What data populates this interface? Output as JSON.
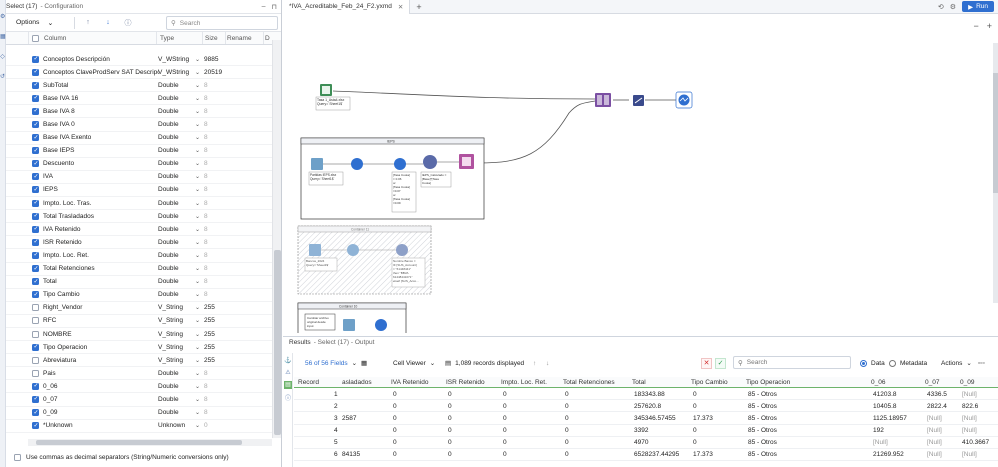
{
  "config": {
    "title": "Select (17)",
    "subtitle": "- Configuration",
    "options_label": "Options",
    "search_placeholder": "Search",
    "headers": {
      "column": "Column",
      "type": "Type",
      "size": "Size",
      "rename": "Rename",
      "desc": "D"
    },
    "rows": [
      {
        "name": "Conceptos Descripción",
        "type": "V_WString",
        "size": "9885",
        "checked": true
      },
      {
        "name": "Conceptos ClaveProdServ SAT Descripción",
        "type": "V_WString",
        "size": "20519",
        "checked": true
      },
      {
        "name": "SubTotal",
        "type": "Double",
        "size": "8",
        "checked": true
      },
      {
        "name": "Base IVA 16",
        "type": "Double",
        "size": "8",
        "checked": true
      },
      {
        "name": "Base IVA 8",
        "type": "Double",
        "size": "8",
        "checked": true
      },
      {
        "name": "Base IVA 0",
        "type": "Double",
        "size": "8",
        "checked": true
      },
      {
        "name": "Base IVA Exento",
        "type": "Double",
        "size": "8",
        "checked": true
      },
      {
        "name": "Base IEPS",
        "type": "Double",
        "size": "8",
        "checked": true
      },
      {
        "name": "Descuento",
        "type": "Double",
        "size": "8",
        "checked": true
      },
      {
        "name": "IVA",
        "type": "Double",
        "size": "8",
        "checked": true
      },
      {
        "name": "IEPS",
        "type": "Double",
        "size": "8",
        "checked": true
      },
      {
        "name": "Impto. Loc. Tras.",
        "type": "Double",
        "size": "8",
        "checked": true
      },
      {
        "name": "Total Trasladados",
        "type": "Double",
        "size": "8",
        "checked": true
      },
      {
        "name": "IVA Retenido",
        "type": "Double",
        "size": "8",
        "checked": true
      },
      {
        "name": "ISR Retenido",
        "type": "Double",
        "size": "8",
        "checked": true
      },
      {
        "name": "Impto. Loc. Ret.",
        "type": "Double",
        "size": "8",
        "checked": true
      },
      {
        "name": "Total Retenciones",
        "type": "Double",
        "size": "8",
        "checked": true
      },
      {
        "name": "Total",
        "type": "Double",
        "size": "8",
        "checked": true
      },
      {
        "name": "Tipo Cambio",
        "type": "Double",
        "size": "8",
        "checked": true
      },
      {
        "name": "Right_Vendor",
        "type": "V_String",
        "size": "255",
        "checked": false
      },
      {
        "name": "RFC",
        "type": "V_String",
        "size": "255",
        "checked": false
      },
      {
        "name": "NOMBRE",
        "type": "V_String",
        "size": "255",
        "checked": false
      },
      {
        "name": "Tipo Operacion",
        "type": "V_String",
        "size": "255",
        "checked": true
      },
      {
        "name": "Abreviatura",
        "type": "V_String",
        "size": "255",
        "checked": false
      },
      {
        "name": "Pais",
        "type": "Double",
        "size": "8",
        "checked": false
      },
      {
        "name": "0_06",
        "type": "Double",
        "size": "8",
        "checked": true
      },
      {
        "name": "0_07",
        "type": "Double",
        "size": "8",
        "checked": true
      },
      {
        "name": "0_09",
        "type": "Double",
        "size": "8",
        "checked": true
      },
      {
        "name": "*Unknown",
        "type": "Unknown",
        "size": "0",
        "checked": true
      }
    ],
    "footer_label": "Use commas as decimal separators (String/Numeric conversions only)"
  },
  "tabs": [
    {
      "label": "*IVA_Acreditable_Feb_24_F2.yxmd"
    }
  ],
  "run_label": "Run",
  "canvas": {
    "container1_title": "IEPS",
    "container2_title": "Container 11",
    "container3_title": "Container 10",
    "input1_label": "Tasa 1_Asta4.xlsx Query=`Sheet1$`",
    "input2_label": "Partidas IEPS.xlsx Query=`Sheet1$`",
    "filter_label": "[Tasa Cuota] = 0.06 or [Tasa Cuota] =0.07 or [Tasa Cuota] =0.09",
    "formula_label": "IEPS_Calculado = [Base]*[Tasa Cuota]",
    "input3_label": "Bancos_2024 Query=`Sheet1$`",
    "formula2_label": "Nombre Banco = IF [SUS_Account] = \"61448441\" then \"BBVA 61448441071\" elseif [SUS_Acco...",
    "text_label": "Cambiar archivo original desde input"
  },
  "results": {
    "title": "Results",
    "subtitle": "- Select (17) - Output",
    "fields_label": "56 of 56 Fields",
    "viewer_label": "Cell Viewer",
    "records_label": "1,089 records displayed",
    "search_placeholder": "Search",
    "data_label": "Data",
    "metadata_label": "Metadata",
    "actions_label": "Actions",
    "headers": [
      "Record",
      "asladados",
      "IVA Retenido",
      "ISR Retenido",
      "Impto. Loc. Ret.",
      "Total Retenciones",
      "Total",
      "Tipo Cambio",
      "Tipo Operacion",
      "0_06",
      "0_07",
      "0_09"
    ],
    "rows": [
      [
        "1",
        "",
        "0",
        "0",
        "0",
        "0",
        "183343.88",
        "0",
        "85 - Otros",
        "41203.8",
        "4336.5",
        "[Null]"
      ],
      [
        "2",
        "",
        "0",
        "0",
        "0",
        "0",
        "257620.8",
        "0",
        "85 - Otros",
        "10405.8",
        "2822.4",
        "822.6"
      ],
      [
        "3",
        "2587",
        "0",
        "0",
        "0",
        "0",
        "345346.57455",
        "17.373",
        "85 - Otros",
        "1125.18957",
        "[Null]",
        "[Null]"
      ],
      [
        "4",
        "",
        "0",
        "0",
        "0",
        "0",
        "3392",
        "0",
        "85 - Otros",
        "192",
        "[Null]",
        "[Null]"
      ],
      [
        "5",
        "",
        "0",
        "0",
        "0",
        "0",
        "4970",
        "0",
        "85 - Otros",
        "[Null]",
        "[Null]",
        "410.3667"
      ],
      [
        "6",
        "84135",
        "0",
        "0",
        "0",
        "0",
        "6528237.44295",
        "17.373",
        "85 - Otros",
        "21269.952",
        "[Null]",
        "[Null]"
      ]
    ]
  }
}
